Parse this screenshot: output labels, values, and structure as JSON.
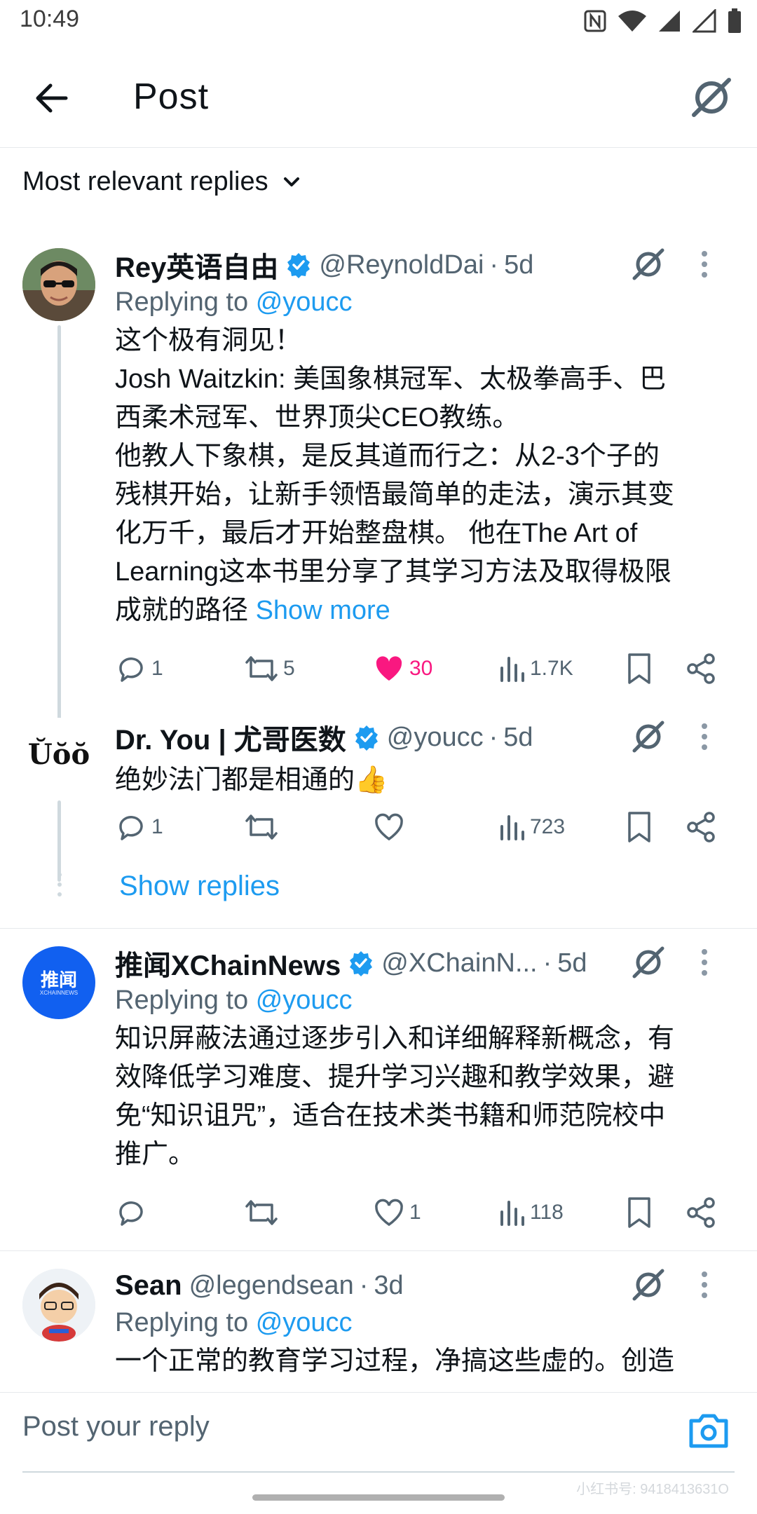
{
  "status_bar": {
    "time": "10:49"
  },
  "header": {
    "title": "Post"
  },
  "filter": {
    "label": "Most relevant replies"
  },
  "replies": [
    {
      "name": "Rey英语自由",
      "handle": "@ReynoldDai",
      "time": "5d",
      "replying_prefix": "Replying to",
      "replying_to": "@youcc",
      "text_lines": [
        "这个极有洞见！",
        "Josh Waitzkin: 美国象棋冠军、太极拳高手、巴",
        "西柔术冠军、世界顶尖CEO教练。",
        "他教人下象棋，是反其道而行之：从2-3个子的",
        "残棋开始，让新手领悟最简单的走法，演示其变",
        "化万千，最后才开始整盘棋。 他在The Art of",
        "Learning这本书里分享了其学习方法及取得极限",
        "成就的路径"
      ],
      "show_more": "Show more",
      "replies_count": "1",
      "reposts": "5",
      "likes": "30",
      "views": "1.7K"
    },
    {
      "name": "Dr. You | 尤哥医数",
      "avatar_text": "Ŭŏŏ",
      "handle": "@youcc",
      "time": "5d",
      "text": "绝妙法门都是相通的👍",
      "replies_count": "1",
      "views": "723"
    },
    {
      "name": "推闻XChainNews",
      "avatar_text": "推闻",
      "avatar_subtext": "XCHAINNEWS",
      "handle": "@XChainN...",
      "time": "5d",
      "replying_prefix": "Replying to",
      "replying_to": "@youcc",
      "text_lines": [
        "知识屏蔽法通过逐步引入和详细解释新概念，有",
        "效降低学习难度、提升学习兴趣和教学效果，避",
        "免“知识诅咒”，适合在技术类书籍和师范院校中",
        "推广。"
      ],
      "likes": "1",
      "views": "118"
    },
    {
      "name": "Sean",
      "handle": "@legendsean",
      "time": "3d",
      "replying_prefix": "Replying to",
      "replying_to": "@youcc",
      "text": "一个正常的教育学习过程，净搞这些虚的。创造"
    }
  ],
  "show_replies": "Show replies",
  "composer": {
    "placeholder": "Post your reply"
  },
  "watermark": "小红书号: 9418413631O",
  "colors": {
    "link": "#1d9bf0",
    "like": "#f91880",
    "verified": "#1d9bf0",
    "muted": "#536471"
  }
}
